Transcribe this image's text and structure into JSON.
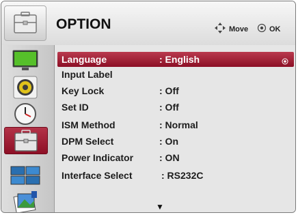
{
  "header": {
    "title": "OPTION",
    "icon": "toolbox-icon",
    "help": {
      "move_icon": "four-way-arrow-icon",
      "move_label": "Move",
      "ok_icon": "ok-circle-icon",
      "ok_label": "OK"
    }
  },
  "sidebar": {
    "items": [
      {
        "name": "picture",
        "icon": "monitor-icon"
      },
      {
        "name": "audio",
        "icon": "speaker-icon"
      },
      {
        "name": "time",
        "icon": "clock-icon"
      },
      {
        "name": "option",
        "icon": "toolbox-icon",
        "active": true
      },
      {
        "name": "tile",
        "icon": "tile-screens-icon"
      },
      {
        "name": "extra",
        "icon": "photo-stack-icon"
      }
    ]
  },
  "menu": {
    "items": [
      {
        "label": "Language",
        "value": ": English",
        "selected": true
      },
      {
        "label": "Input Label",
        "value": ""
      },
      {
        "label": "Key Lock",
        "value": ": Off"
      },
      {
        "label": "Set ID",
        "value": ": Off"
      },
      {
        "label": "ISM Method",
        "value": ": Normal"
      },
      {
        "label": "DPM Select",
        "value": ": On"
      },
      {
        "label": "Power Indicator",
        "value": ": ON"
      },
      {
        "label": "Interface Select",
        "value": ": RS232C"
      }
    ],
    "scroll_indicator": "▼"
  },
  "colors": {
    "accent": "#9e1c33",
    "background": "#e6e6e6"
  }
}
